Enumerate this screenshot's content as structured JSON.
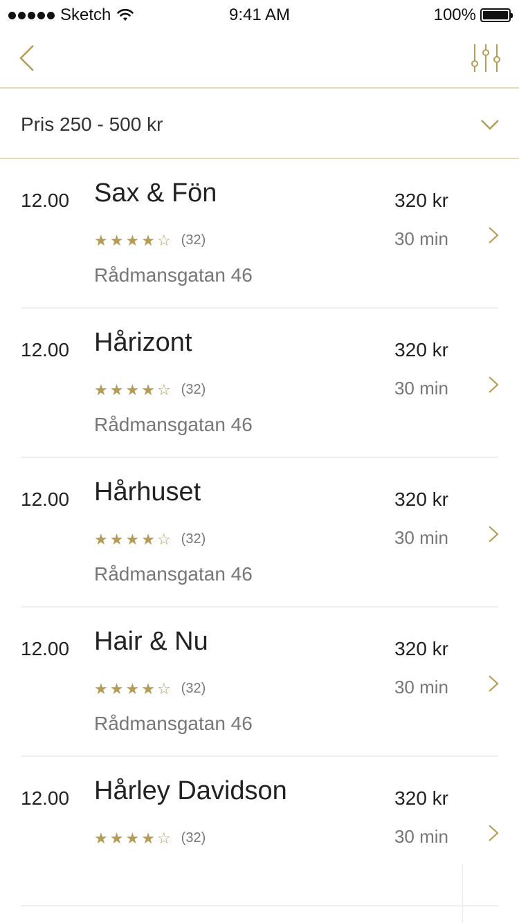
{
  "status_bar": {
    "carrier": "Sketch",
    "time": "9:41 AM",
    "battery": "100%"
  },
  "nav": {
    "back_icon": "chevron-left-icon",
    "filter_icon": "sliders-icon",
    "accent_color": "#b59b55"
  },
  "price_filter": {
    "label": "Pris 250 - 500 kr"
  },
  "salons": [
    {
      "time": "12.00",
      "name": "Sax & Fön",
      "price": "320 kr",
      "duration": "30 min",
      "rating": 4,
      "reviews": "(32)",
      "address": "Rådmansgatan 46"
    },
    {
      "time": "12.00",
      "name": "Hårizont",
      "price": "320 kr",
      "duration": "30 min",
      "rating": 4,
      "reviews": "(32)",
      "address": "Rådmansgatan 46"
    },
    {
      "time": "12.00",
      "name": "Hårhuset",
      "price": "320 kr",
      "duration": "30 min",
      "rating": 4,
      "reviews": "(32)",
      "address": "Rådmansgatan 46"
    },
    {
      "time": "12.00",
      "name": "Hair & Nu",
      "price": "320 kr",
      "duration": "30 min",
      "rating": 4,
      "reviews": "(32)",
      "address": "Rådmansgatan 46"
    },
    {
      "time": "12.00",
      "name": "Hårley Davidson",
      "price": "320 kr",
      "duration": "30 min",
      "rating": 4,
      "reviews": "(32)",
      "address": ""
    }
  ]
}
